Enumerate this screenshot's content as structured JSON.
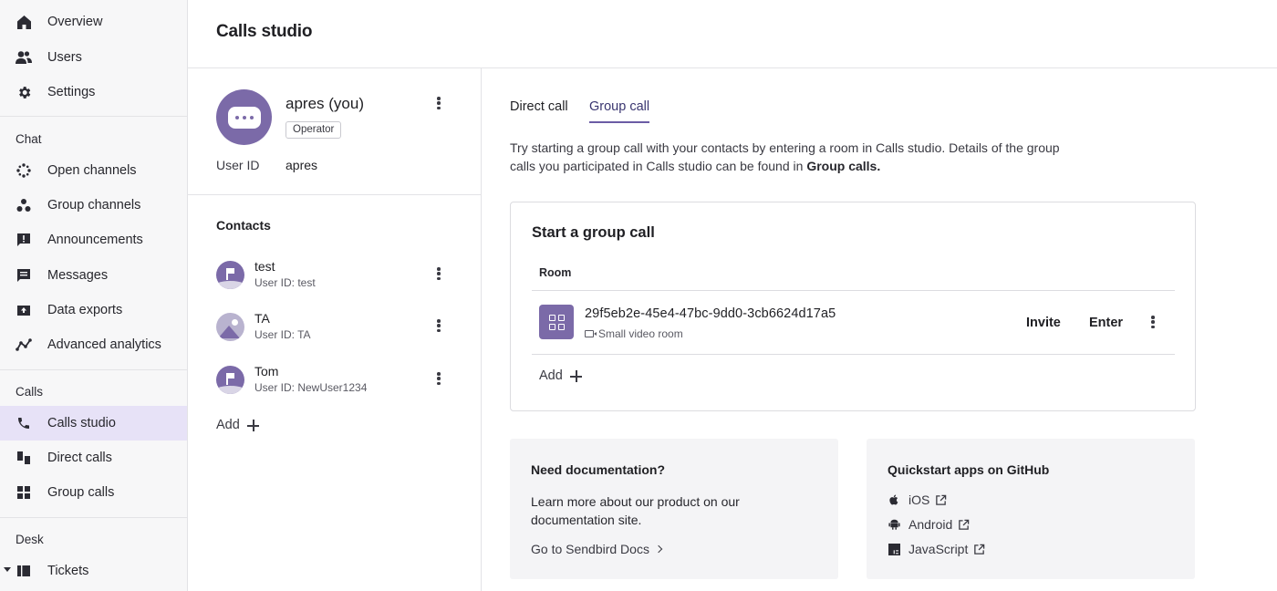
{
  "sidebar": {
    "top_items": [
      {
        "label": "Overview",
        "icon": "home-icon"
      },
      {
        "label": "Users",
        "icon": "users-icon"
      },
      {
        "label": "Settings",
        "icon": "gear-icon"
      }
    ],
    "sections": [
      {
        "title": "Chat",
        "items": [
          {
            "label": "Open channels",
            "icon": "open-channels-icon"
          },
          {
            "label": "Group channels",
            "icon": "group-channels-icon"
          },
          {
            "label": "Announcements",
            "icon": "announcement-icon"
          },
          {
            "label": "Messages",
            "icon": "messages-icon"
          },
          {
            "label": "Data exports",
            "icon": "data-export-icon"
          },
          {
            "label": "Advanced analytics",
            "icon": "analytics-icon"
          }
        ]
      },
      {
        "title": "Calls",
        "items": [
          {
            "label": "Calls studio",
            "icon": "phone-icon",
            "active": true
          },
          {
            "label": "Direct calls",
            "icon": "direct-calls-icon"
          },
          {
            "label": "Group calls",
            "icon": "group-calls-icon"
          }
        ]
      },
      {
        "title": "Desk",
        "items": [
          {
            "label": "Tickets",
            "icon": "ticket-icon"
          }
        ]
      }
    ]
  },
  "header": {
    "title": "Calls studio"
  },
  "profile": {
    "name": "apres (you)",
    "role": "Operator",
    "user_id_label": "User ID",
    "user_id": "apres"
  },
  "contacts": {
    "title": "Contacts",
    "items": [
      {
        "name": "test",
        "user_id": "User ID: test"
      },
      {
        "name": "TA",
        "user_id": "User ID: TA"
      },
      {
        "name": "Tom",
        "user_id": "User ID: NewUser1234"
      }
    ],
    "add_label": "Add"
  },
  "tabs": [
    {
      "label": "Direct call",
      "active": false
    },
    {
      "label": "Group call",
      "active": true
    }
  ],
  "description": {
    "text": "Try starting a group call with your contacts by entering a room in Calls studio. Details of the group calls you participated in Calls studio can be found in ",
    "link": "Group calls."
  },
  "group_call": {
    "title": "Start a group call",
    "room_label": "Room",
    "room": {
      "id": "29f5eb2e-45e4-47bc-9dd0-3cb6624d17a5",
      "type": "Small video room"
    },
    "invite_label": "Invite",
    "enter_label": "Enter",
    "add_label": "Add"
  },
  "docs_panel": {
    "title": "Need documentation?",
    "text": "Learn more about our product on our documentation site.",
    "link": "Go to Sendbird Docs"
  },
  "github_panel": {
    "title": "Quickstart apps on GitHub",
    "links": [
      {
        "label": "iOS",
        "icon": "apple-icon"
      },
      {
        "label": "Android",
        "icon": "android-icon"
      },
      {
        "label": "JavaScript",
        "icon": "javascript-icon"
      }
    ]
  },
  "colors": {
    "accent": "#7b6aa8",
    "active_nav_bg": "#e7e2f7",
    "sidebar_bg": "#f7f7f8",
    "panel_bg": "#f4f4f6"
  }
}
